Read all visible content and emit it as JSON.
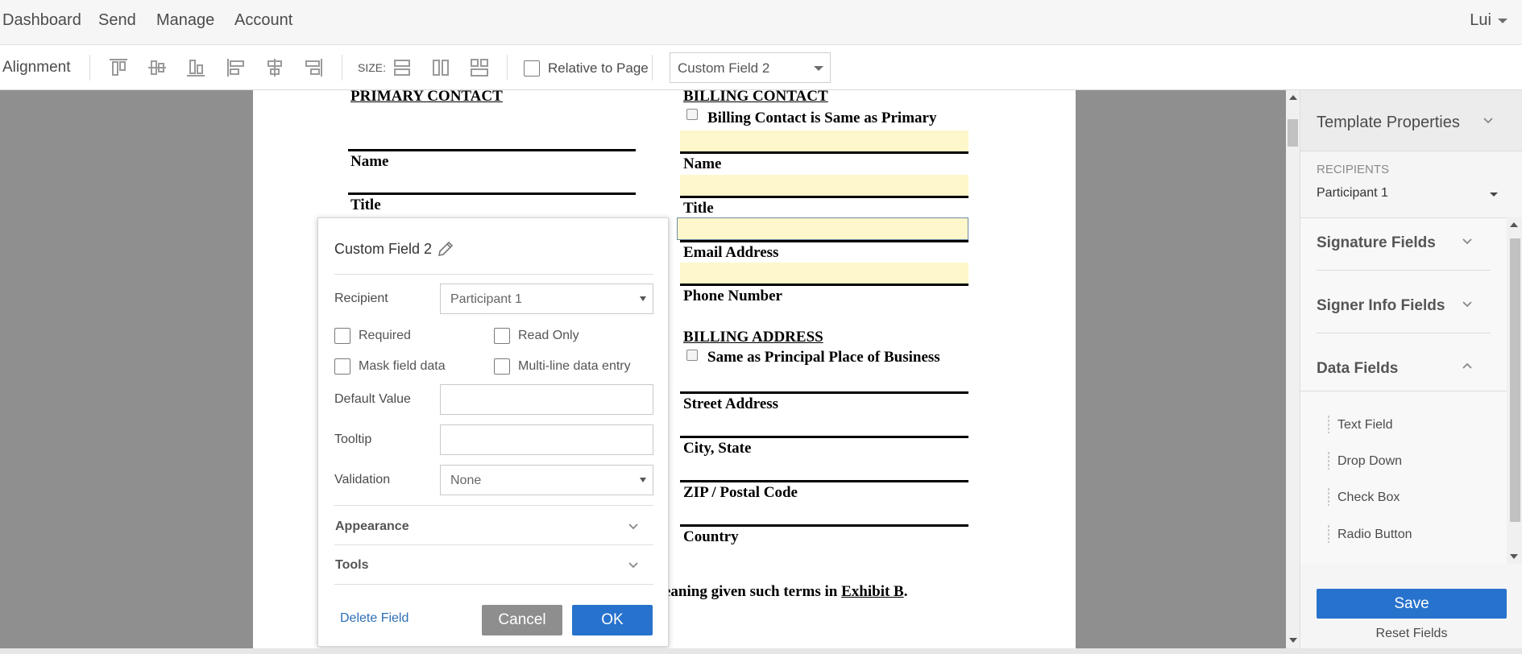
{
  "nav": {
    "items": [
      "Dashboard",
      "Send",
      "Manage",
      "Account"
    ],
    "user": "Lui"
  },
  "toolbar": {
    "alignment_label": "Alignment",
    "alignment_icons": [
      "align-top-icon",
      "align-middle-icon",
      "align-bottom-icon",
      "align-left-icon",
      "align-center-icon",
      "align-right-icon"
    ],
    "size_label": "SIZE:",
    "size_icons": [
      "same-width-icon",
      "same-height-icon",
      "same-size-icon"
    ],
    "relative_label": "Relative to Page",
    "field_select": "Custom Field 2"
  },
  "document": {
    "primary_heading": "PRIMARY CONTACT",
    "primary_fields": [
      "Name",
      "Title"
    ],
    "billing_heading": "BILLING CONTACT",
    "billing_same": "Billing Contact is Same as Primary",
    "billing_fields": [
      "Name",
      "Title",
      "Email Address",
      "Phone Number"
    ],
    "address_heading": "BILLING ADDRESS",
    "address_same": "Same as Principal Place of Business",
    "address_fields": [
      "Street Address",
      "City, State",
      "ZIP / Postal Code",
      "Country"
    ],
    "footer_text": "eaning given such terms in ",
    "footer_link": "Exhibit B",
    "footer_end": "."
  },
  "dialog": {
    "title": "Custom Field 2",
    "recipient_label": "Recipient",
    "recipient_value": "Participant 1",
    "required_label": "Required",
    "readonly_label": "Read Only",
    "mask_label": "Mask field data",
    "multiline_label": "Multi-line data entry",
    "default_label": "Default Value",
    "default_value": "",
    "tooltip_label": "Tooltip",
    "tooltip_value": "",
    "validation_label": "Validation",
    "validation_value": "None",
    "appearance_label": "Appearance",
    "tools_label": "Tools",
    "delete_label": "Delete Field",
    "cancel_label": "Cancel",
    "ok_label": "OK"
  },
  "panel": {
    "title": "Template Properties",
    "recipients_label": "RECIPIENTS",
    "recipient_value": "Participant 1",
    "sections": [
      "Signature Fields",
      "Signer Info Fields",
      "Data Fields"
    ],
    "data_fields": [
      "Text Field",
      "Drop Down",
      "Check Box",
      "Radio Button"
    ],
    "save_label": "Save",
    "reset_label": "Reset Fields"
  },
  "colors": {
    "accent": "#2772cd",
    "field_highlight": "#fef7cc",
    "cancel": "#8e8e8e",
    "link": "#2d6fb5"
  }
}
